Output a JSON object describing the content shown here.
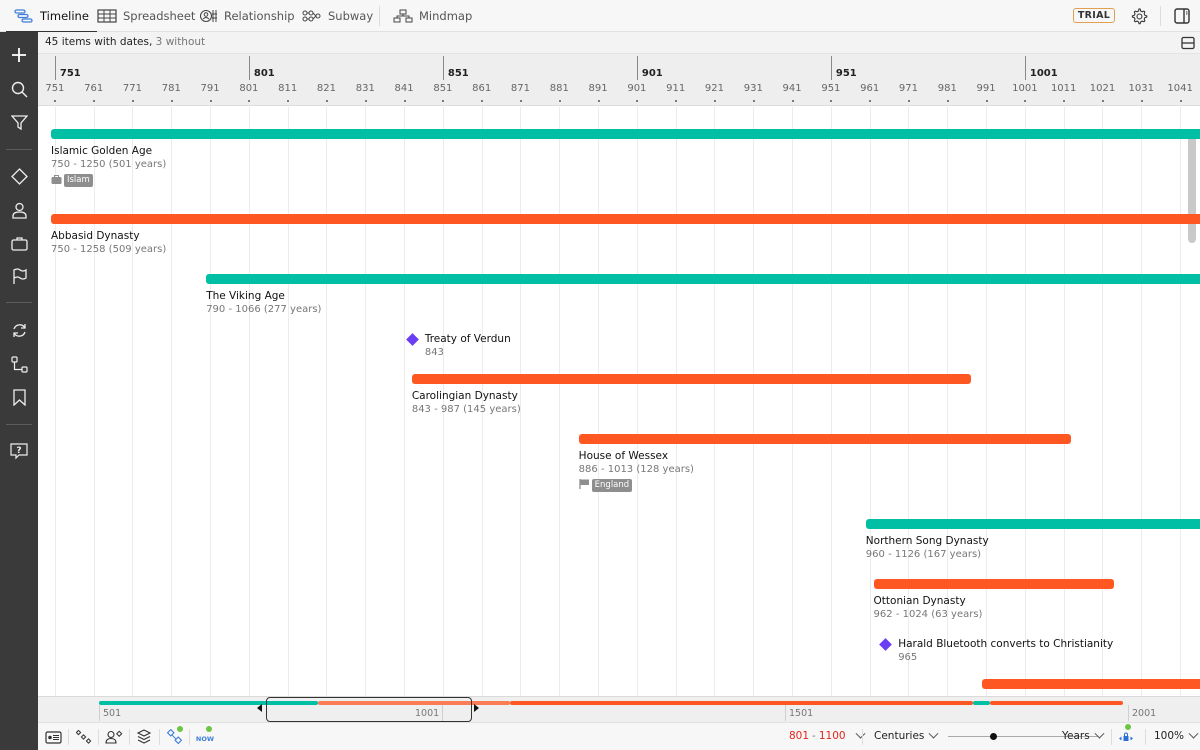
{
  "tabs": [
    {
      "label": "Timeline",
      "icon": "timeline-icon",
      "active": true
    },
    {
      "label": "Spreadsheet",
      "icon": "spreadsheet-icon",
      "active": false
    },
    {
      "label": "Relationship",
      "icon": "relationship-icon",
      "active": false
    },
    {
      "label": "Subway",
      "icon": "subway-icon",
      "active": false
    },
    {
      "label": "Mindmap",
      "icon": "mindmap-icon",
      "active": false
    }
  ],
  "header": {
    "trial_badge": "TRIAL",
    "settings_icon": "gear-icon",
    "panel_icon": "sidebar-panel-icon"
  },
  "sidebar": {
    "items": [
      {
        "name": "add",
        "icon": "plus-icon"
      },
      {
        "name": "search",
        "icon": "search-icon"
      },
      {
        "name": "filter",
        "icon": "filter-icon"
      },
      {
        "name": "milestones",
        "icon": "diamond-icon"
      },
      {
        "name": "people",
        "icon": "person-icon"
      },
      {
        "name": "groups",
        "icon": "briefcase-icon"
      },
      {
        "name": "tags",
        "icon": "flag-icon"
      },
      {
        "name": "sync",
        "icon": "refresh-icon"
      },
      {
        "name": "relationships",
        "icon": "connection-icon"
      },
      {
        "name": "bookmarks",
        "icon": "bookmark-icon"
      },
      {
        "name": "help",
        "icon": "help-icon"
      }
    ]
  },
  "infobar": {
    "count_text": "45 items with dates,",
    "without_text": "3 without"
  },
  "ruler": {
    "start_year": 750,
    "major_labels": [
      "751",
      "801",
      "851",
      "901",
      "951",
      "1001"
    ],
    "minor_labels": [
      "751",
      "761",
      "771",
      "781",
      "791",
      "801",
      "811",
      "821",
      "831",
      "841",
      "851",
      "861",
      "871",
      "881",
      "891",
      "901",
      "911",
      "921",
      "931",
      "941",
      "951",
      "961",
      "971",
      "981",
      "991",
      "1001",
      "1011",
      "1021",
      "1031",
      "1041"
    ]
  },
  "colors": {
    "teal": "#00bfa5",
    "orange": "#ff5722",
    "milestone": "#6b3ef5",
    "range_red": "#e3261d"
  },
  "items": [
    {
      "title": "Islamic Golden Age",
      "subtitle": "750 - 1250 (501 years)",
      "start": 750,
      "end": 1250,
      "color": "teal",
      "tag": "Islam",
      "tag_icon": "briefcase-icon"
    },
    {
      "title": "Abbasid Dynasty",
      "subtitle": "750 - 1258 (509 years)",
      "start": 750,
      "end": 1258,
      "color": "orange"
    },
    {
      "title": "The Viking Age",
      "subtitle": "790 - 1066 (277 years)",
      "start": 790,
      "end": 1066,
      "color": "teal"
    },
    {
      "title": "Treaty of Verdun",
      "subtitle": "843",
      "start": 843,
      "milestone": true
    },
    {
      "title": "Carolingian Dynasty",
      "subtitle": "843 - 987 (145 years)",
      "start": 843,
      "end": 987,
      "color": "orange"
    },
    {
      "title": "House of Wessex",
      "subtitle": "886 - 1013 (128 years)",
      "start": 886,
      "end": 1013,
      "color": "orange",
      "tag": "England",
      "tag_icon": "flag-icon"
    },
    {
      "title": "Northern Song Dynasty",
      "subtitle": "960 - 1126 (167 years)",
      "start": 960,
      "end": 1126,
      "color": "teal"
    },
    {
      "title": "Ottonian Dynasty",
      "subtitle": "962 - 1024 (63 years)",
      "start": 962,
      "end": 1024,
      "color": "orange"
    },
    {
      "title": "Harald Bluetooth converts to Christianity",
      "subtitle": "965",
      "start": 965,
      "milestone": true
    },
    {
      "title": "",
      "subtitle": "",
      "start": 990,
      "end": 1200,
      "color": "orange"
    }
  ],
  "overview": {
    "labels": [
      "501",
      "1001",
      "1501",
      "2001"
    ],
    "window_range": [
      801,
      1100
    ]
  },
  "bottombar": {
    "icons": [
      "card-view-icon",
      "scatter-icon",
      "people-groups-icon",
      "layers-icon",
      "relationship-toggle-icon",
      "now-icon"
    ],
    "now_label": "NOW",
    "range_start": "801",
    "range_sep": "-",
    "range_end": "1100",
    "scale_min": "Centuries",
    "scale_max": "Years",
    "zoom_level": 0.3,
    "zoom_percent": "100%"
  }
}
